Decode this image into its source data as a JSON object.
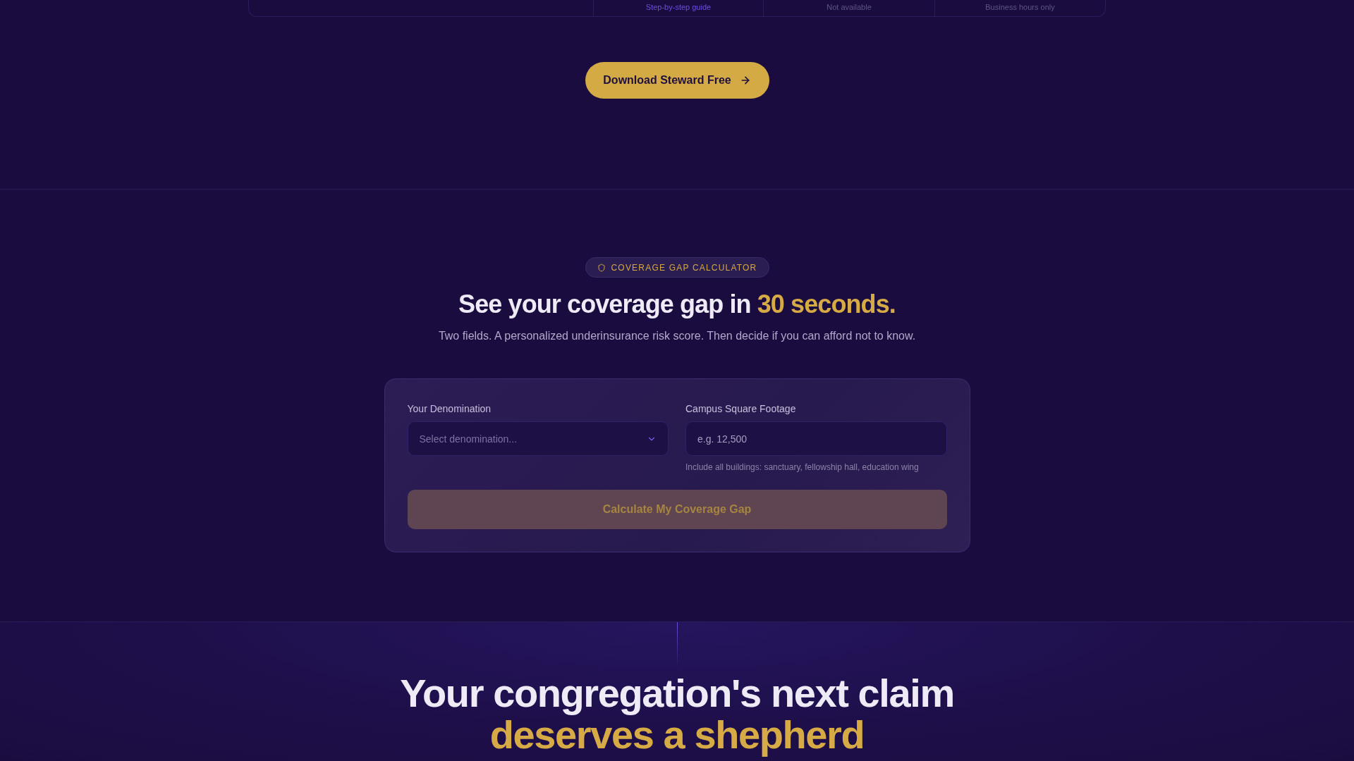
{
  "comparison_table": {
    "visible_row": [
      {
        "text": "Step-by-step guide",
        "highlighted": true
      },
      {
        "text": "Not available",
        "highlighted": false
      },
      {
        "text": "Business hours only",
        "highlighted": false
      }
    ]
  },
  "cta_button": {
    "label": "Download Steward Free"
  },
  "calculator": {
    "badge": "COVERAGE GAP CALCULATOR",
    "heading": {
      "text": "See your coverage gap in",
      "highlight": "30 seconds."
    },
    "subtitle": "Two fields. A personalized underinsurance risk score. Then decide if you can afford not to know.",
    "fields": [
      {
        "kind": "select",
        "label": "Your Denomination",
        "placeholder": "Select denomination..."
      },
      {
        "kind": "input",
        "label": "Campus Square Footage",
        "placeholder": "e.g. 12,500",
        "hint": "Include all buildings: sanctuary, fellowship hall, education wing"
      }
    ],
    "submit": {
      "label": "Calculate My Coverage Gap",
      "disabled": true
    }
  },
  "closing": {
    "heading": {
      "text": "Your congregation's next claim",
      "highlight": "deserves a shepherd"
    }
  }
}
